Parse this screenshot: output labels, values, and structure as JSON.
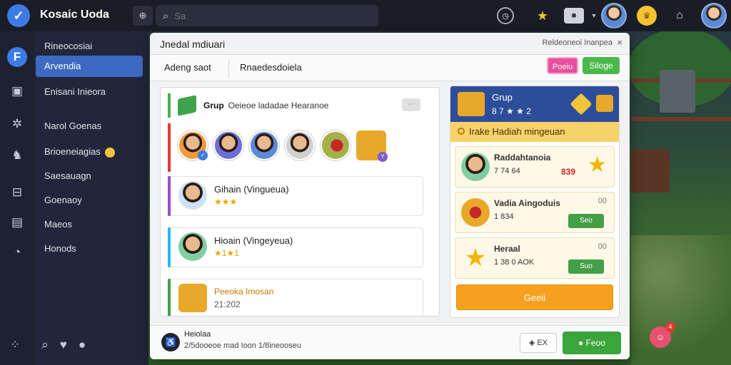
{
  "app": {
    "title": "Kosaic Uoda"
  },
  "search": {
    "placeholder": "Sa",
    "filter_label": "⊕"
  },
  "topbar": {
    "gift_count": ""
  },
  "sidebar": {
    "items": [
      {
        "label": "Rineocosiai"
      },
      {
        "label": "Arvendia"
      },
      {
        "label": "Enisani Inieora"
      },
      {
        "label": "Narol Goenas"
      },
      {
        "label": "Brioeneiagias"
      },
      {
        "label": "Saesauagn"
      },
      {
        "label": "Goenaoy"
      },
      {
        "label": "Maeos"
      },
      {
        "label": "Honods"
      }
    ]
  },
  "panel": {
    "title": "Jnedal mdiuari",
    "right_label": "Reldeoneoi Inanpea",
    "close_label": "×",
    "tabs": [
      "Adeng saot",
      "Rnaedesdoiela"
    ],
    "btn_pink": "Poeiu",
    "btn_green": "Siloge"
  },
  "left": {
    "group_label": "Grup",
    "group_desc": "Oeieoe ladadae Hearanoe",
    "group_badge": "⋯",
    "rows": [
      {
        "title": "Gihain (Vingueua)",
        "sub": "★★★"
      },
      {
        "title": "Hioain (Vingeyeua)",
        "sub": "★1★1"
      },
      {
        "title": "Peeoka Imosan",
        "sub": "21:202"
      }
    ]
  },
  "right": {
    "header_title": "Grup",
    "header_sub": "8 7 ★ ★ 2",
    "banner": "Irake Hadiah mingeuan",
    "items": [
      {
        "title": "Raddahtanoia",
        "sub": "7 74 64",
        "value": "839"
      },
      {
        "title": "Vadia Aingoduis",
        "sub": "1 834",
        "value": "00",
        "btn": "Seo"
      },
      {
        "title": "Heraal",
        "sub": "1 38 0 AOK",
        "value": "00",
        "btn": "Suo"
      }
    ],
    "action": "Geeii"
  },
  "footer": {
    "title": "Heiolaa",
    "sub": "2/5dooeoe mad Ioon 1/8ineooseu",
    "btn1": "EX",
    "btn2": "Feoo"
  },
  "notif_count": "4",
  "colors": {
    "accent": "#3d7be6",
    "green": "#4bb84b",
    "pink": "#e84f9c",
    "orange": "#f7a020",
    "header_blue": "#2c4e9a"
  }
}
